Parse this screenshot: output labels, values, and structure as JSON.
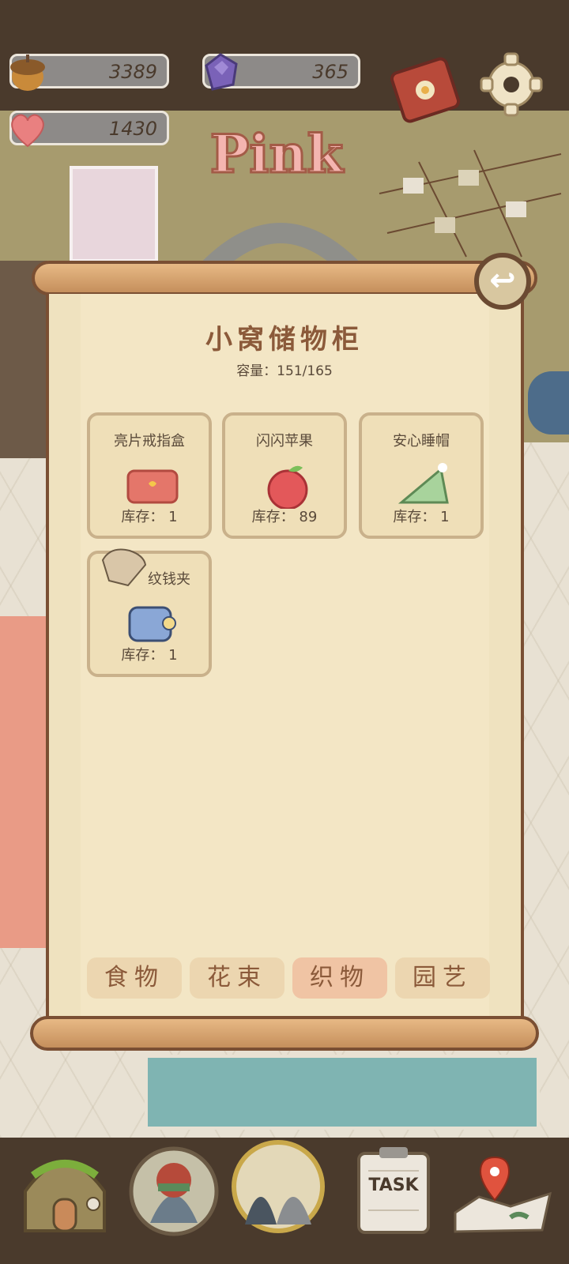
{
  "resources": {
    "acorn_icon": "acorn-icon",
    "acorn_value": "3389",
    "gem_icon": "gem-icon",
    "gem_value": "365",
    "heart_icon": "heart-icon",
    "heart_value": "1430"
  },
  "header": {
    "logo_text": "Pink",
    "book_icon": "book-icon",
    "settings_icon": "gear-icon"
  },
  "storage": {
    "title": "小窝储物柜",
    "capacity": "容量：151/165",
    "items": [
      {
        "name": "亮片戒指盒",
        "stock": "库存： 1",
        "icon": "ring-box-icon"
      },
      {
        "name": "闪闪苹果",
        "stock": "库存： 89",
        "icon": "sparkle-apple-icon"
      },
      {
        "name": "安心睡帽",
        "stock": "库存： 1",
        "icon": "sleep-cap-icon"
      },
      {
        "name": "纹钱夹",
        "stock": "库存： 1",
        "icon": "wallet-icon"
      }
    ],
    "tabs": [
      {
        "label": "食物"
      },
      {
        "label": "花束"
      },
      {
        "label": "织物"
      },
      {
        "label": "园艺"
      }
    ],
    "active_tab": "织物"
  },
  "bottom_nav": {
    "home_icon": "house-icon",
    "avatar_icon": "penguin-avatar-icon",
    "pair_icon": "friends-icon",
    "task_label": "TASK",
    "map_icon": "map-icon"
  },
  "colors": {
    "accent": "#8b5a3a",
    "panel": "#f3e6c5",
    "active_tab": "#f0c4a4"
  }
}
